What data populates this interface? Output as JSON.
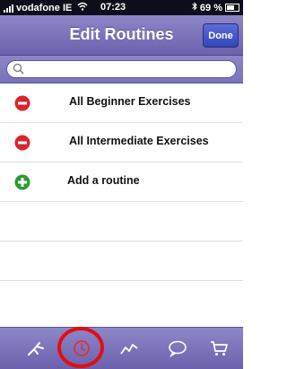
{
  "status_bar": {
    "carrier": "vodafone IE",
    "time": "07:23",
    "battery": "69 %"
  },
  "nav": {
    "title": "Edit Routines",
    "done_label": "Done"
  },
  "search": {
    "placeholder": ""
  },
  "routines": [
    {
      "label": "All Beginner Exercises",
      "action": "delete"
    },
    {
      "label": "All Intermediate Exercises",
      "action": "delete"
    }
  ],
  "add_row": {
    "label": "Add a routine",
    "action": "add"
  },
  "tab_bar": {
    "items": [
      {
        "icon": "runner-icon"
      },
      {
        "icon": "clock-icon",
        "selected": true
      },
      {
        "icon": "chart-icon"
      },
      {
        "icon": "speech-bubble-icon"
      },
      {
        "icon": "cart-icon"
      }
    ]
  },
  "colors": {
    "bar": "#7a72ba",
    "delete": "#d8252d",
    "add": "#2e9a34",
    "highlight": "#e01010"
  }
}
